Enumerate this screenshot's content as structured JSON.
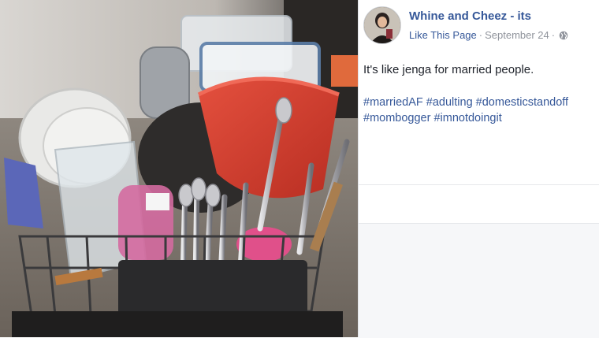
{
  "post": {
    "page_name": "Whine and Cheez - its",
    "like_label": "Like This Page",
    "separator": "·",
    "date": "September 24",
    "text": "It's like jenga for married people.",
    "hashtags": [
      "#marriedAF",
      "#adulting",
      "#domesticstandoff",
      "#mombogger",
      "#imnotdoingit"
    ],
    "privacy_icon": "globe-icon"
  },
  "photo": {
    "subject": "dish drying rack overloaded with dishes"
  },
  "colors": {
    "link": "#365899",
    "text": "#1d2129",
    "meta": "#90949c"
  }
}
